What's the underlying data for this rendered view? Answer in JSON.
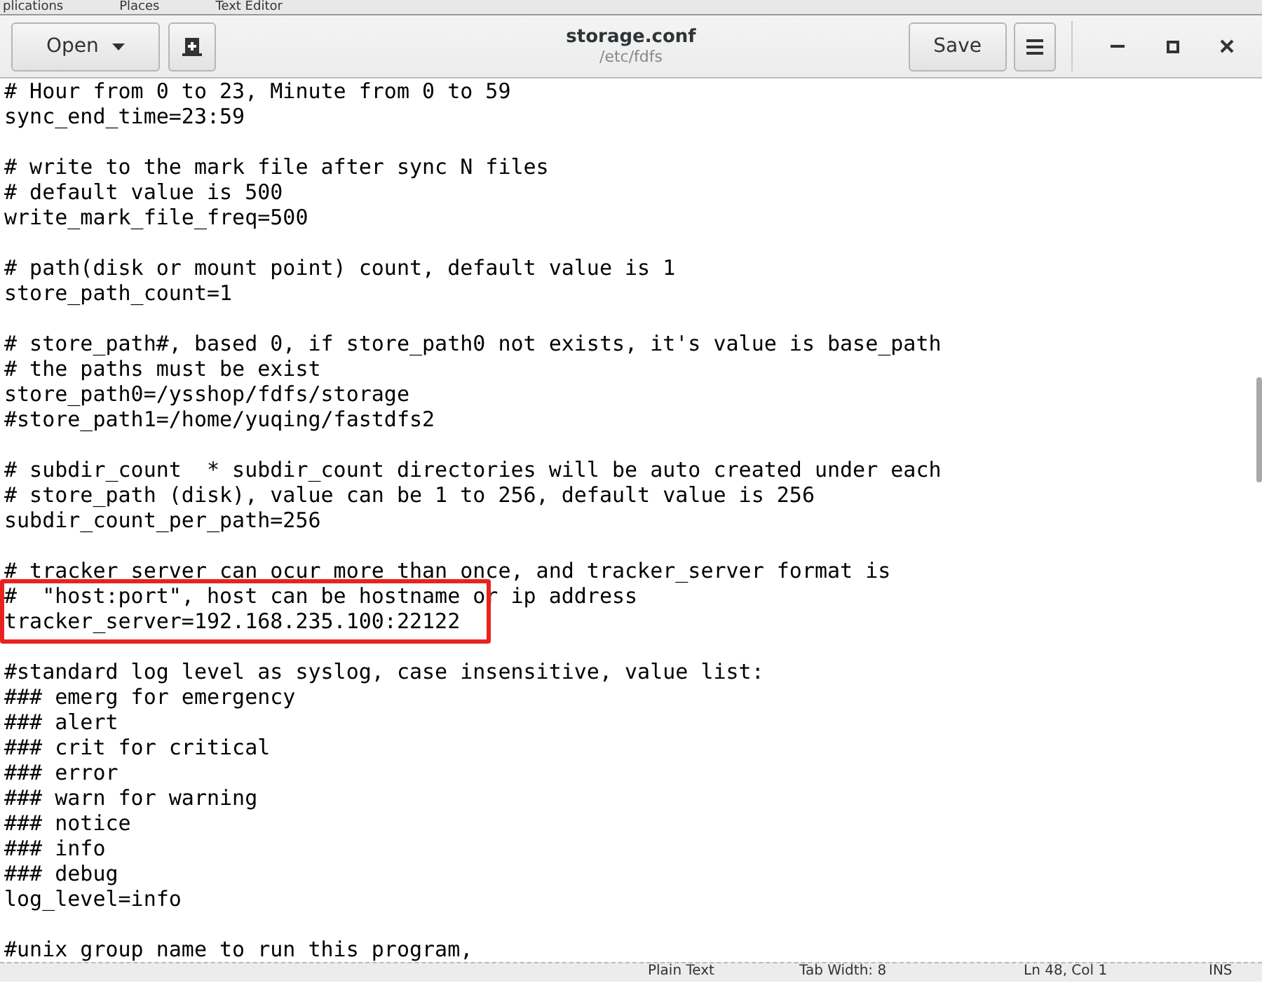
{
  "top_bar": {
    "items": [
      "plications",
      "Places",
      "Text Editor"
    ]
  },
  "header": {
    "open_button": "Open",
    "title": "storage.conf",
    "subtitle": "/etc/fdfs",
    "save_button": "Save"
  },
  "editor": {
    "lines": [
      {
        "kind": "code",
        "text": "# Hour from 0 to 23, Minute from 0 to 59",
        "highlighted": false
      },
      {
        "kind": "code",
        "text": "sync_end_time=23:59",
        "highlighted": false
      },
      {
        "kind": "blank"
      },
      {
        "kind": "code",
        "text": "# write to the mark file after sync N files",
        "highlighted": false
      },
      {
        "kind": "code",
        "text": "# default value is 500",
        "highlighted": false
      },
      {
        "kind": "code",
        "text": "write_mark_file_freq=500",
        "highlighted": false
      },
      {
        "kind": "blank"
      },
      {
        "kind": "code",
        "text": "# path(disk or mount point) count, default value is 1",
        "highlighted": false
      },
      {
        "kind": "code",
        "text": "store_path_count=1",
        "highlighted": false
      },
      {
        "kind": "blank"
      },
      {
        "kind": "code",
        "text": "# store_path#, based 0, if store_path0 not exists, it's value is base_path",
        "highlighted": false
      },
      {
        "kind": "code",
        "text": "# the paths must be exist",
        "highlighted": false
      },
      {
        "kind": "code",
        "text": "store_path0=/ysshop/fdfs/storage",
        "highlighted": false
      },
      {
        "kind": "code",
        "text": "#store_path1=/home/yuqing/fastdfs2",
        "highlighted": false
      },
      {
        "kind": "blank"
      },
      {
        "kind": "code",
        "text": "# subdir_count  * subdir_count directories will be auto created under each",
        "highlighted": false
      },
      {
        "kind": "code",
        "text": "# store_path (disk), value can be 1 to 256, default value is 256",
        "highlighted": false
      },
      {
        "kind": "code",
        "text": "subdir_count_per_path=256",
        "highlighted": false
      },
      {
        "kind": "blank"
      },
      {
        "kind": "code",
        "text": "# tracker_server can ocur more than once, and tracker_server format is",
        "highlighted": false
      },
      {
        "kind": "code",
        "text": "#  \"host:port\", host can be hostname or ip address",
        "highlighted": true
      },
      {
        "kind": "code",
        "text": "tracker_server=192.168.235.100:22122",
        "highlighted": true
      },
      {
        "kind": "blank"
      },
      {
        "kind": "code",
        "text": "#standard log level as syslog, case insensitive, value list:",
        "highlighted": false
      },
      {
        "kind": "code",
        "text": "### emerg for emergency",
        "highlighted": false
      },
      {
        "kind": "code",
        "text": "### alert",
        "highlighted": false
      },
      {
        "kind": "code",
        "text": "### crit for critical",
        "highlighted": false
      },
      {
        "kind": "code",
        "text": "### error",
        "highlighted": false
      },
      {
        "kind": "code",
        "text": "### warn for warning",
        "highlighted": false
      },
      {
        "kind": "code",
        "text": "### notice",
        "highlighted": false
      },
      {
        "kind": "code",
        "text": "### info",
        "highlighted": false
      },
      {
        "kind": "code",
        "text": "### debug",
        "highlighted": false
      },
      {
        "kind": "code",
        "text": "log_level=info",
        "highlighted": false
      },
      {
        "kind": "blank"
      },
      {
        "kind": "code",
        "text": "#unix group name to run this program,",
        "highlighted": false
      }
    ]
  },
  "status_bar": {
    "language": "Plain Text",
    "tab_width": "Tab Width: 8",
    "position": "Ln 48, Col 1",
    "mode": "INS"
  }
}
